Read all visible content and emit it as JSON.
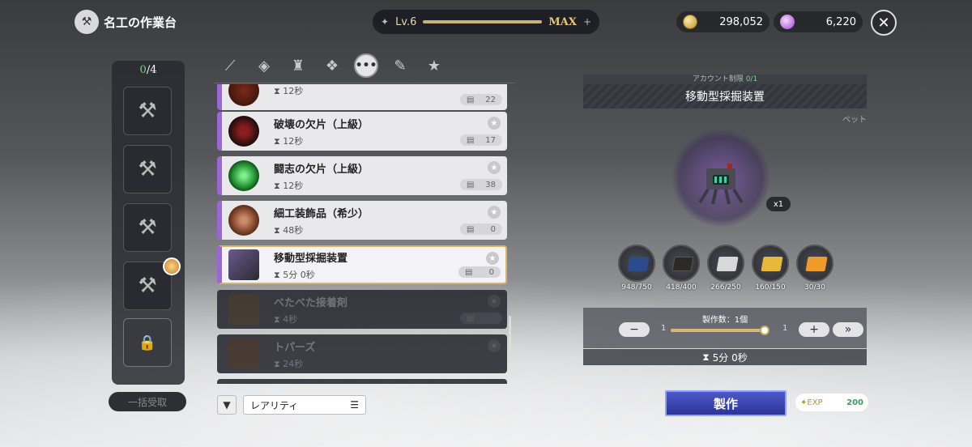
{
  "header": {
    "title": "名工の作業台",
    "level_label": "Lv.6",
    "level_status": "MAX",
    "level_fraction": 1.0,
    "gold": "298,052",
    "gems": "6,220"
  },
  "slots": {
    "counter_used": "0",
    "counter_total": "/4",
    "claim_all_label": "一括受取"
  },
  "tabs": [
    "weapon",
    "armor",
    "top",
    "fox",
    "other",
    "scroll",
    "star"
  ],
  "recipes": [
    {
      "name": "",
      "time": "12秒",
      "count": "22",
      "state": "normal"
    },
    {
      "name": "破壊の欠片（上級）",
      "time": "12秒",
      "count": "17",
      "state": "normal"
    },
    {
      "name": "闘志の欠片（上級）",
      "time": "12秒",
      "count": "38",
      "state": "normal"
    },
    {
      "name": "細工装飾品（希少）",
      "time": "48秒",
      "count": "0",
      "state": "normal"
    },
    {
      "name": "移動型採掘装置",
      "time": "5分 0秒",
      "count": "0",
      "state": "selected"
    },
    {
      "name": "べたべた接着剤",
      "time": "4秒",
      "count": "",
      "state": "locked"
    },
    {
      "name": "トパーズ",
      "time": "24秒",
      "count": "",
      "state": "locked"
    }
  ],
  "filter": {
    "sort_label": "レアリティ"
  },
  "detail": {
    "account_limit_label": "アカウント制限",
    "account_limit_value": "0/1",
    "item_name": "移動型採掘装置",
    "item_category": "ペット",
    "quantity_badge": "x1",
    "materials": [
      {
        "name": "blue-ore",
        "count": "948/750",
        "color": "#2c4b8a"
      },
      {
        "name": "dark-ore",
        "count": "418/400",
        "color": "#2b2a28"
      },
      {
        "name": "silver-ingot",
        "count": "266/250",
        "color": "#d8d8da"
      },
      {
        "name": "gold-ingot",
        "count": "160/150",
        "color": "#e8b83a"
      },
      {
        "name": "amber-crystal",
        "count": "30/30",
        "color": "#f09a2a"
      }
    ],
    "craft_count_label": "製作数：1個",
    "qty_min": "1",
    "qty_max": "1",
    "craft_time": "5分 0秒",
    "craft_button": "製作",
    "exp_label": "EXP",
    "exp_value": "200"
  },
  "colors": {
    "accent_purple": "#9b66d6",
    "craft_blue": "#3d47b8",
    "gold": "#e8c873"
  }
}
